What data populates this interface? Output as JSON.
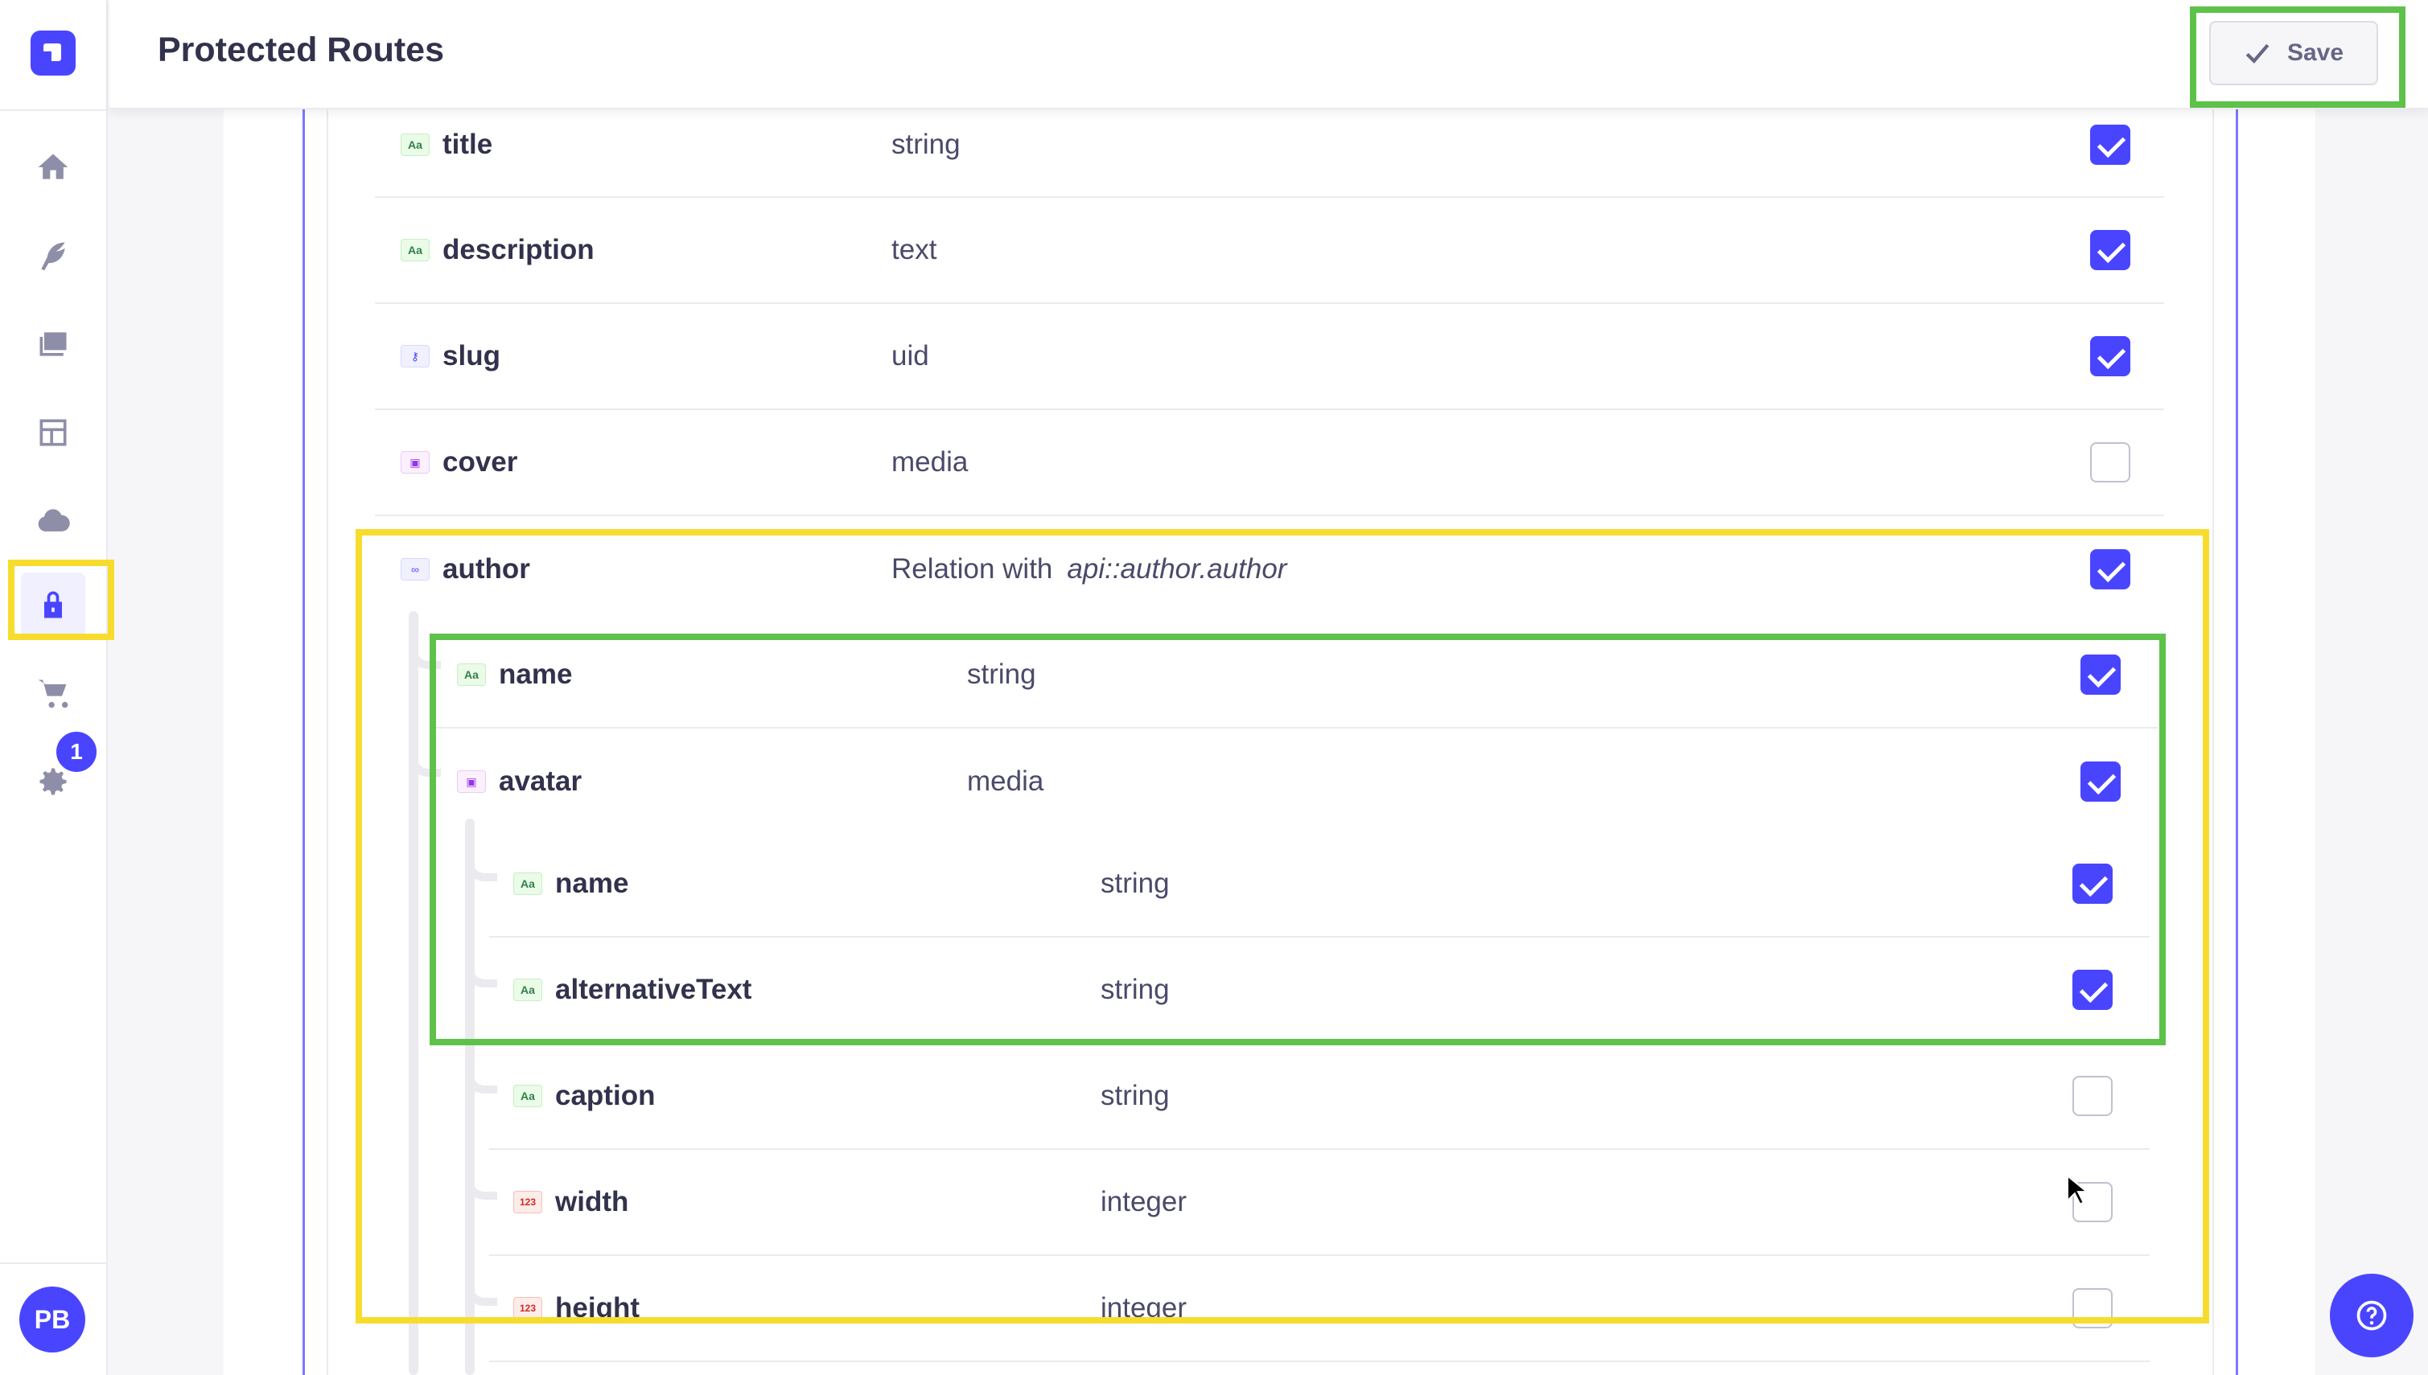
{
  "header": {
    "title": "Protected Routes",
    "save_label": "Save"
  },
  "sidebar": {
    "items": [
      {
        "icon": "home-icon"
      },
      {
        "icon": "feather-icon"
      },
      {
        "icon": "media-library-icon"
      },
      {
        "icon": "layout-icon"
      },
      {
        "icon": "cloud-icon"
      },
      {
        "icon": "lock-icon",
        "active": true
      },
      {
        "icon": "cart-icon"
      },
      {
        "icon": "gear-icon",
        "badge": "1"
      }
    ],
    "avatar_initials": "PB"
  },
  "fields": [
    {
      "name": "title",
      "type": "string",
      "icon": "Aa",
      "checked": true
    },
    {
      "name": "description",
      "type": "text",
      "icon": "Aa",
      "checked": true
    },
    {
      "name": "slug",
      "type": "uid",
      "icon": "key",
      "checked": true
    },
    {
      "name": "cover",
      "type": "media",
      "icon": "img",
      "checked": false
    },
    {
      "name": "author",
      "type": "Relation with",
      "relation": "api::author.author",
      "icon": "link",
      "checked": true
    }
  ],
  "author_fields": [
    {
      "name": "name",
      "type": "string",
      "icon": "Aa",
      "checked": true
    },
    {
      "name": "avatar",
      "type": "media",
      "icon": "img",
      "checked": true
    }
  ],
  "avatar_fields": [
    {
      "name": "name",
      "type": "string",
      "icon": "Aa",
      "checked": true
    },
    {
      "name": "alternativeText",
      "type": "string",
      "icon": "Aa",
      "checked": true
    },
    {
      "name": "caption",
      "type": "string",
      "icon": "Aa",
      "checked": false
    },
    {
      "name": "width",
      "type": "integer",
      "icon": "123",
      "checked": false
    },
    {
      "name": "height",
      "type": "integer",
      "icon": "123",
      "checked": false
    }
  ],
  "colors": {
    "primary": "#4945ff",
    "highlight_yellow": "#f7dc2e",
    "highlight_green": "#5ec24a"
  }
}
